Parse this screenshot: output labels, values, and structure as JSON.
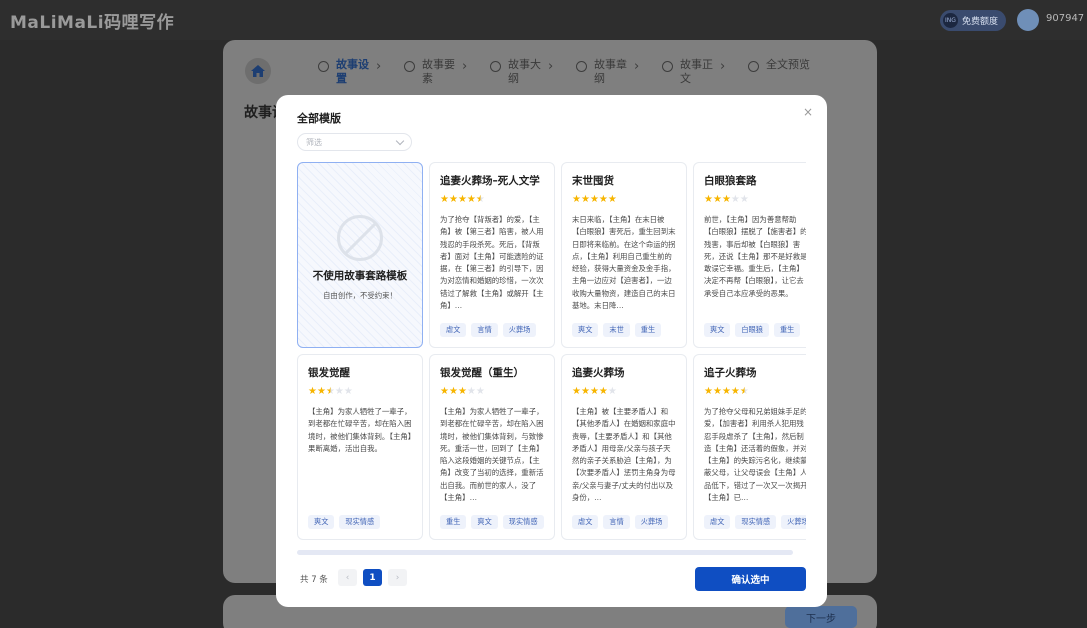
{
  "app": {
    "logo": "MaLiMaLi码哩写作",
    "points_label": "免费额度",
    "points_badge": "ING",
    "user_id": "907947"
  },
  "steps": [
    {
      "label": "故事设置",
      "active": true
    },
    {
      "label": "故事要素",
      "active": false
    },
    {
      "label": "故事大纲",
      "active": false
    },
    {
      "label": "故事章纲",
      "active": false
    },
    {
      "label": "故事正文",
      "active": false
    },
    {
      "label": "全文预览",
      "active": false
    }
  ],
  "page": {
    "heading": "故事设",
    "next_label": "下一步"
  },
  "modal": {
    "title": "全部模版",
    "close": "×",
    "filter_placeholder": "筛选",
    "no_template": {
      "title": "不使用故事套路模板",
      "subtitle": "自由创作，不受约束！"
    },
    "cards": [
      {
        "title": "追妻火葬场–死人文学",
        "rating": 4.5,
        "desc": "为了抢夺【背叛者】的爱，【主角】被【第三者】陷害，被人用残忍的手段杀死。死后，【背叛者】面对【主角】可能遗险的证据，在【第三者】的引导下，因为对恋情和婚姻的珍惜，一次次错过了解救【主角】或解开【主角】…",
        "tags": [
          "虐文",
          "言情",
          "火葬场"
        ]
      },
      {
        "title": "末世囤货",
        "rating": 5,
        "desc": "末日来临，【主角】在末日被【白眼狼】害死后，重生回到末日即将来临前。在这个命运的拐点，【主角】利用自己重生前的经验，获得大量资金及金手指，主角一边应对【迫害者】，一边收购大量物资，建造自己的末日基地。末日降…",
        "tags": [
          "爽文",
          "末世",
          "重生"
        ]
      },
      {
        "title": "白眼狼套路",
        "rating": 3,
        "desc": "前世，【主角】因为善意帮助【白眼狼】摆脱了【施害者】的残害，事后却被【白眼狼】害死，还说【主角】那不是好救是敢误它幸福。重生后，【主角】决定不再帮【白眼狼】，让它去承受自己本应承受的恶果。",
        "tags": [
          "爽文",
          "白眼狼",
          "重生"
        ]
      },
      {
        "title": "银发觉醒",
        "rating": 2.5,
        "desc": "【主角】为家人牺牲了一辈子，到老都在忙碌辛苦，却在陷入困境时，被他们集体背刺。【主角】果断离婚，活出自我。",
        "tags": [
          "爽文",
          "现实情感"
        ]
      },
      {
        "title": "银发觉醒（重生）",
        "rating": 3,
        "desc": "【主角】为家人牺牲了一辈子，到老都在忙碌辛苦，却在陷入困境时，被他们集体背刺，与致惨死。重活一世，回到了【主角】陷入这段婚姻的关键节点，【主角】改变了当初的选择，重新活出自我。而前世的家人，没了【主角】…",
        "tags": [
          "重生",
          "爽文",
          "现实情感"
        ]
      },
      {
        "title": "追妻火葬场",
        "rating": 4,
        "desc": "【主角】被【主要矛盾人】和【其他矛盾人】在婚姻和家庭中责辱，【主要矛盾人】和【其他矛盾人】用母亲/父亲与孩子天然的亲子关系胁迫【主角】，为【次要矛盾人】惩罚主角身为母亲/父亲与妻子/丈夫的付出以及身份，…",
        "tags": [
          "虐文",
          "言情",
          "火葬场"
        ]
      },
      {
        "title": "追子火葬场",
        "rating": 4.5,
        "desc": "为了抢夺父母和兄弟姐妹手足的爱，【加害者】利用杀人犯用残忍手段虐杀了【主角】，然后制造【主角】还活着的假象，并对【主角】的失踪污名化，继续蒙蔽父母，让父母误会【主角】人品低下，错过了一次又一次揭开【主角】已…",
        "tags": [
          "虐文",
          "现实情感",
          "火葬场"
        ]
      }
    ],
    "pagination": {
      "total_text": "共 7 条",
      "prev": "‹",
      "current": "1",
      "next": "›"
    },
    "confirm_label": "确认选中"
  },
  "colors": {
    "primary": "#0f4ec2",
    "star": "#f7b500",
    "tag_text": "#3f63b5",
    "tag_bg": "#eef2fb"
  }
}
